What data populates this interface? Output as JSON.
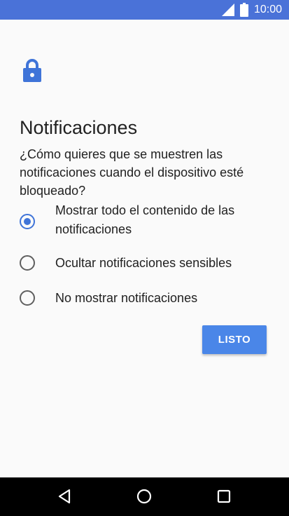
{
  "status_bar": {
    "time": "10:00",
    "icons": [
      "signal-icon",
      "battery-icon"
    ],
    "background_color": "#4a72d8"
  },
  "header": {
    "icon": "lock-icon",
    "title": "Notificaciones",
    "description": "¿Cómo quieres que se muestren las notificaciones cuando el dispositivo esté bloqueado?"
  },
  "options": [
    {
      "label": "Mostrar todo el contenido de las notificaciones",
      "selected": true
    },
    {
      "label": "Ocultar notificaciones sensibles",
      "selected": false
    },
    {
      "label": "No mostrar notificaciones",
      "selected": false
    }
  ],
  "done_button": {
    "label": "LISTO",
    "color": "#4a86e8"
  },
  "nav_bar": {
    "buttons": [
      "back-icon",
      "home-icon",
      "recents-icon"
    ]
  },
  "accent_color": "#3f74d8"
}
